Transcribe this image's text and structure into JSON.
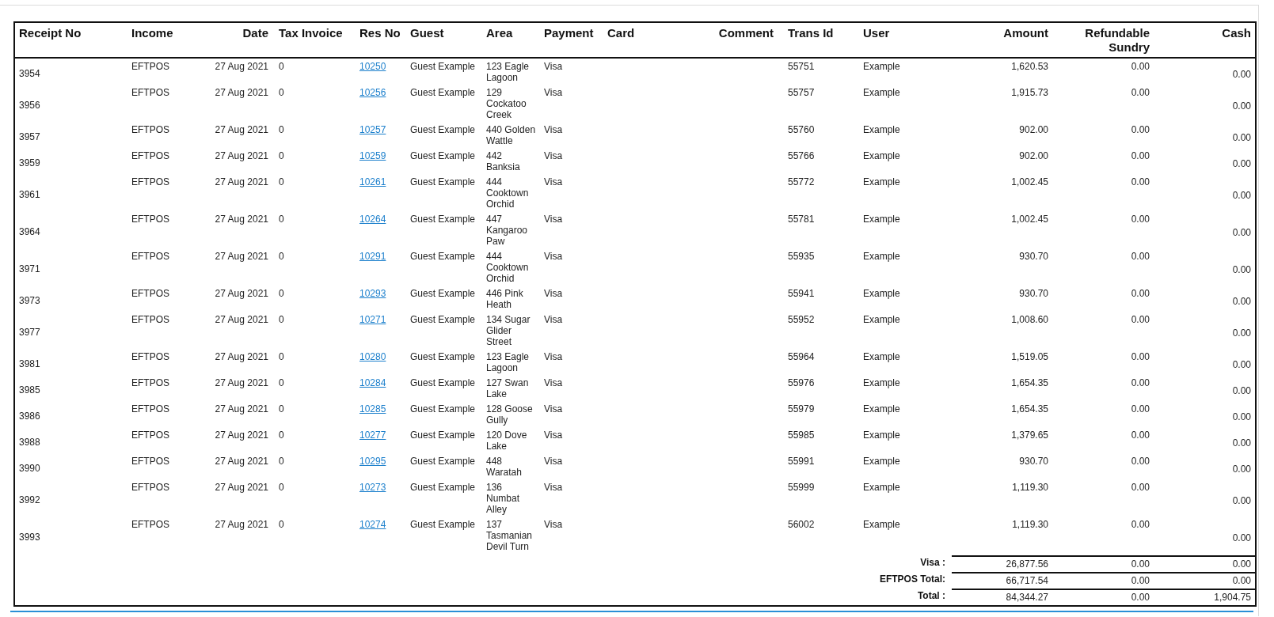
{
  "table": {
    "columns": [
      "Receipt No",
      "Income",
      "Date",
      "Tax Invoice",
      "Res No",
      "Guest",
      "Area",
      "Payment",
      "Card",
      "Comment",
      "Trans Id",
      "User",
      "Amount",
      "Refundable Sundry",
      "Cash"
    ],
    "rows": [
      {
        "receipt_no": "3954",
        "income": "EFTPOS",
        "date": "27 Aug 2021",
        "tax_invoice": "0",
        "res_no": "10250",
        "guest": "Guest Example",
        "area": "123 Eagle Lagoon",
        "payment": "Visa",
        "trans_id": "55751",
        "user": "Example",
        "amount": "1,620.53",
        "refundable_sundry": "0.00",
        "cash": "0.00"
      },
      {
        "receipt_no": "3956",
        "income": "EFTPOS",
        "date": "27 Aug 2021",
        "tax_invoice": "0",
        "res_no": "10256",
        "guest": "Guest Example",
        "area": "129 Cockatoo Creek",
        "payment": "Visa",
        "trans_id": "55757",
        "user": "Example",
        "amount": "1,915.73",
        "refundable_sundry": "0.00",
        "cash": "0.00"
      },
      {
        "receipt_no": "3957",
        "income": "EFTPOS",
        "date": "27 Aug 2021",
        "tax_invoice": "0",
        "res_no": "10257",
        "guest": "Guest Example",
        "area": "440 Golden Wattle",
        "payment": "Visa",
        "trans_id": "55760",
        "user": "Example",
        "amount": "902.00",
        "refundable_sundry": "0.00",
        "cash": "0.00"
      },
      {
        "receipt_no": "3959",
        "income": "EFTPOS",
        "date": "27 Aug 2021",
        "tax_invoice": "0",
        "res_no": "10259",
        "guest": "Guest Example",
        "area": "442 Banksia",
        "payment": "Visa",
        "trans_id": "55766",
        "user": "Example",
        "amount": "902.00",
        "refundable_sundry": "0.00",
        "cash": "0.00"
      },
      {
        "receipt_no": "3961",
        "income": "EFTPOS",
        "date": "27 Aug 2021",
        "tax_invoice": "0",
        "res_no": "10261",
        "guest": "Guest Example",
        "area": "444 Cooktown Orchid",
        "payment": "Visa",
        "trans_id": "55772",
        "user": "Example",
        "amount": "1,002.45",
        "refundable_sundry": "0.00",
        "cash": "0.00"
      },
      {
        "receipt_no": "3964",
        "income": "EFTPOS",
        "date": "27 Aug 2021",
        "tax_invoice": "0",
        "res_no": "10264",
        "guest": "Guest Example",
        "area": "447 Kangaroo Paw",
        "payment": "Visa",
        "trans_id": "55781",
        "user": "Example",
        "amount": "1,002.45",
        "refundable_sundry": "0.00",
        "cash": "0.00"
      },
      {
        "receipt_no": "3971",
        "income": "EFTPOS",
        "date": "27 Aug 2021",
        "tax_invoice": "0",
        "res_no": "10291",
        "guest": "Guest Example",
        "area": "444 Cooktown Orchid",
        "payment": "Visa",
        "trans_id": "55935",
        "user": "Example",
        "amount": "930.70",
        "refundable_sundry": "0.00",
        "cash": "0.00"
      },
      {
        "receipt_no": "3973",
        "income": "EFTPOS",
        "date": "27 Aug 2021",
        "tax_invoice": "0",
        "res_no": "10293",
        "guest": "Guest Example",
        "area": "446 Pink Heath",
        "payment": "Visa",
        "trans_id": "55941",
        "user": "Example",
        "amount": "930.70",
        "refundable_sundry": "0.00",
        "cash": "0.00"
      },
      {
        "receipt_no": "3977",
        "income": "EFTPOS",
        "date": "27 Aug 2021",
        "tax_invoice": "0",
        "res_no": "10271",
        "guest": "Guest Example",
        "area": "134 Sugar Glider Street",
        "payment": "Visa",
        "trans_id": "55952",
        "user": "Example",
        "amount": "1,008.60",
        "refundable_sundry": "0.00",
        "cash": "0.00"
      },
      {
        "receipt_no": "3981",
        "income": "EFTPOS",
        "date": "27 Aug 2021",
        "tax_invoice": "0",
        "res_no": "10280",
        "guest": "Guest Example",
        "area": "123 Eagle Lagoon",
        "payment": "Visa",
        "trans_id": "55964",
        "user": "Example",
        "amount": "1,519.05",
        "refundable_sundry": "0.00",
        "cash": "0.00"
      },
      {
        "receipt_no": "3985",
        "income": "EFTPOS",
        "date": "27 Aug 2021",
        "tax_invoice": "0",
        "res_no": "10284",
        "guest": "Guest Example",
        "area": "127 Swan Lake",
        "payment": "Visa",
        "trans_id": "55976",
        "user": "Example",
        "amount": "1,654.35",
        "refundable_sundry": "0.00",
        "cash": "0.00"
      },
      {
        "receipt_no": "3986",
        "income": "EFTPOS",
        "date": "27 Aug 2021",
        "tax_invoice": "0",
        "res_no": "10285",
        "guest": "Guest Example",
        "area": "128 Goose Gully",
        "payment": "Visa",
        "trans_id": "55979",
        "user": "Example",
        "amount": "1,654.35",
        "refundable_sundry": "0.00",
        "cash": "0.00"
      },
      {
        "receipt_no": "3988",
        "income": "EFTPOS",
        "date": "27 Aug 2021",
        "tax_invoice": "0",
        "res_no": "10277",
        "guest": "Guest Example",
        "area": "120 Dove Lake",
        "payment": "Visa",
        "trans_id": "55985",
        "user": "Example",
        "amount": "1,379.65",
        "refundable_sundry": "0.00",
        "cash": "0.00"
      },
      {
        "receipt_no": "3990",
        "income": "EFTPOS",
        "date": "27 Aug 2021",
        "tax_invoice": "0",
        "res_no": "10295",
        "guest": "Guest Example",
        "area": "448 Waratah",
        "payment": "Visa",
        "trans_id": "55991",
        "user": "Example",
        "amount": "930.70",
        "refundable_sundry": "0.00",
        "cash": "0.00"
      },
      {
        "receipt_no": "3992",
        "income": "EFTPOS",
        "date": "27 Aug 2021",
        "tax_invoice": "0",
        "res_no": "10273",
        "guest": "Guest Example",
        "area": "136 Numbat Alley",
        "payment": "Visa",
        "trans_id": "55999",
        "user": "Example",
        "amount": "1,119.30",
        "refundable_sundry": "0.00",
        "cash": "0.00"
      },
      {
        "receipt_no": "3993",
        "income": "EFTPOS",
        "date": "27 Aug 2021",
        "tax_invoice": "0",
        "res_no": "10274",
        "guest": "Guest Example",
        "area": "137 Tasmanian Devil Turn",
        "payment": "Visa",
        "trans_id": "56002",
        "user": "Example",
        "amount": "1,119.30",
        "refundable_sundry": "0.00",
        "cash": "0.00"
      }
    ],
    "totals": [
      {
        "label": "Visa :",
        "amount": "26,877.56",
        "refundable_sundry": "0.00",
        "cash": "0.00"
      },
      {
        "label": "EFTPOS Total:",
        "amount": "66,717.54",
        "refundable_sundry": "0.00",
        "cash": "0.00"
      },
      {
        "label": "Total :",
        "amount": "84,344.27",
        "refundable_sundry": "0.00",
        "cash": "1,904.75"
      }
    ]
  }
}
